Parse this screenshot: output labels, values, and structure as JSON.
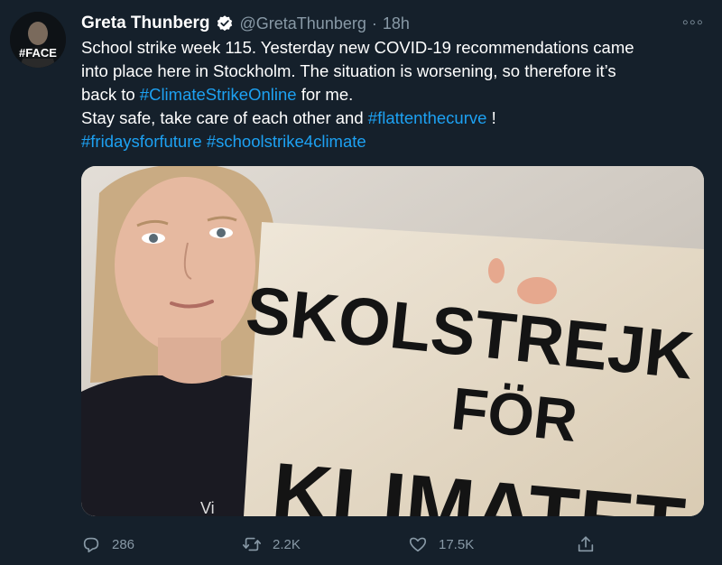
{
  "tweet": {
    "author_name": "Greta Thunberg",
    "handle": "@GretaThunberg",
    "separator": "·",
    "time": "18h",
    "more_label": "◦◦◦",
    "avatar_text": "#FACE",
    "text_lines": [
      {
        "before": "School strike week 115. Yesterday new COVID-19 recommendations came",
        "tag": "",
        "after": ""
      },
      {
        "before": "into place here in Stockholm. The situation is worsening, so therefore it’s",
        "tag": "",
        "after": ""
      },
      {
        "before": "back to ",
        "tag": "#ClimateStrikeOnline",
        "after": " for me."
      },
      {
        "before": "Stay safe, take care of each other and ",
        "tag": "#flattenthecurve",
        "after": " !"
      }
    ],
    "hashtags_line": [
      "#fridaysforfuture",
      "#schoolstrike4climate"
    ],
    "image": {
      "sign_line1": "SKOLSTREJK",
      "sign_line2": "FÖR",
      "sign_line3": "KLIMATET",
      "shirt_text": "Vi"
    }
  },
  "actions": {
    "replies": "286",
    "retweets": "2.2K",
    "likes": "17.5K"
  },
  "colors": {
    "background": "#15202b",
    "link": "#1da1f2",
    "secondary": "#8899a6",
    "verified": "#ffffff"
  }
}
